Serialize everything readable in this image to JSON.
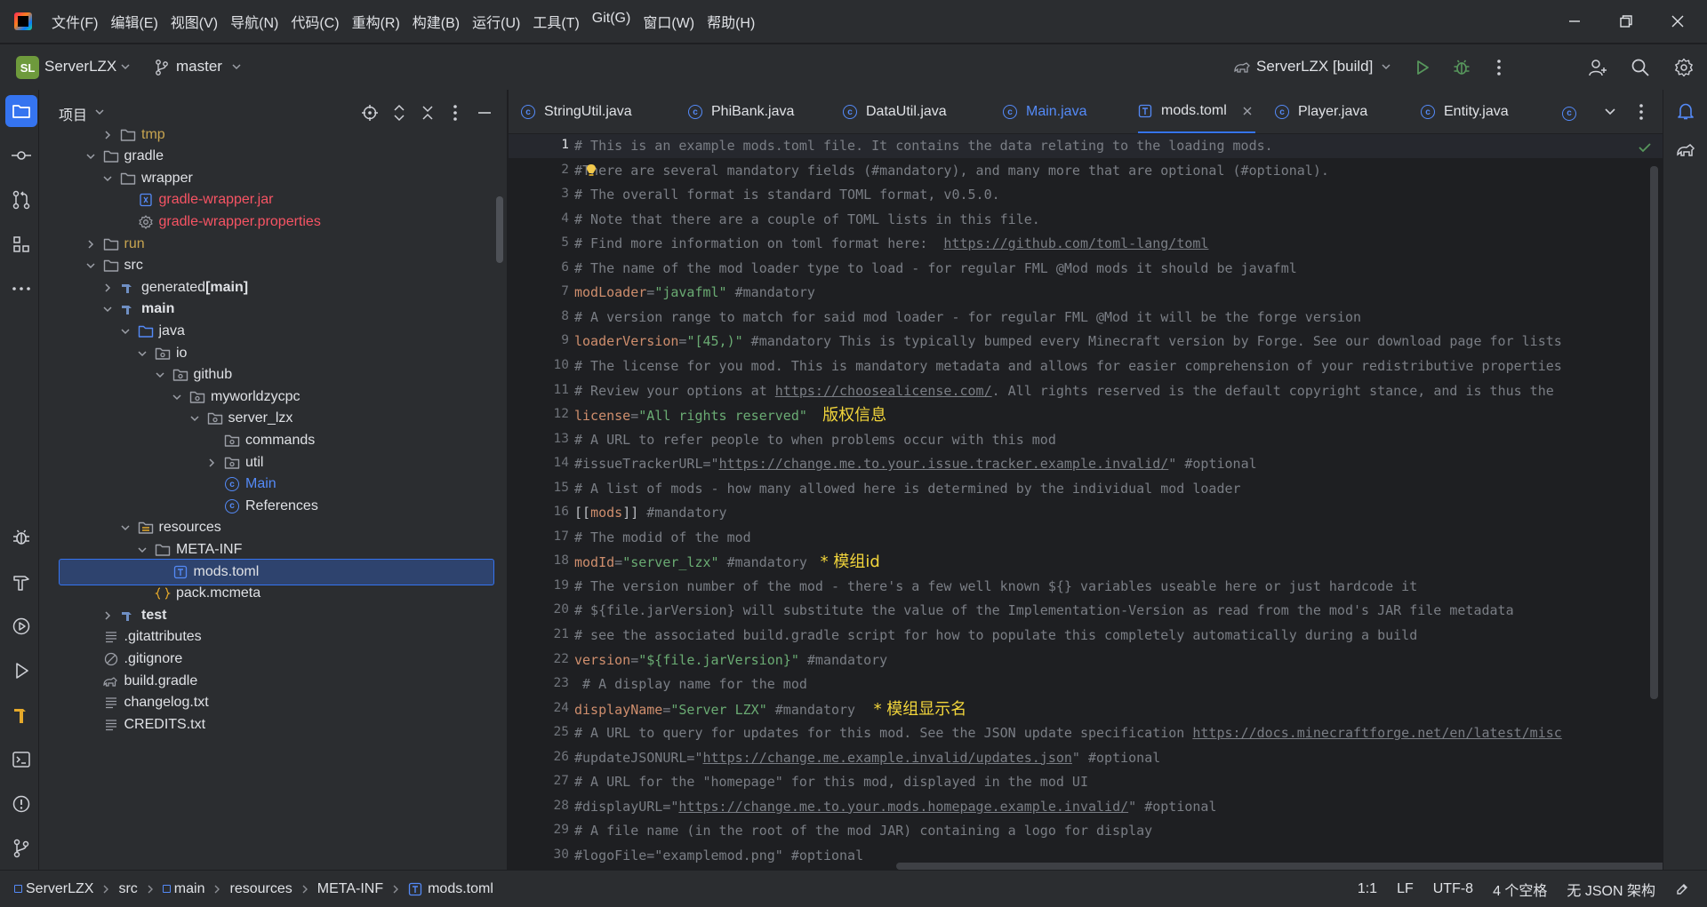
{
  "menubar": {
    "items": [
      "文件(F)",
      "编辑(E)",
      "视图(V)",
      "导航(N)",
      "代码(C)",
      "重构(R)",
      "构建(B)",
      "运行(U)",
      "工具(T)",
      "Git(G)",
      "窗口(W)",
      "帮助(H)"
    ]
  },
  "toolbar": {
    "project_badge": "SL",
    "project_name": "ServerLZX",
    "branch": "master",
    "run_config": "ServerLZX [build]"
  },
  "project_panel": {
    "title": "项目",
    "tree": [
      {
        "label": "tmp",
        "icon": "folder-icon",
        "expanded": false,
        "color": "#c7a450"
      },
      {
        "label": "gradle",
        "icon": "folder-icon",
        "expanded": true,
        "color": "#dfe1e5"
      },
      {
        "label": "wrapper",
        "icon": "folder-icon",
        "expanded": true,
        "color": "#dfe1e5"
      },
      {
        "label": "gradle-wrapper.jar",
        "icon": "jar-icon",
        "color": "#f75464"
      },
      {
        "label": "gradle-wrapper.properties",
        "icon": "gear-icon",
        "color": "#f75464"
      },
      {
        "label": "run",
        "icon": "folder-icon",
        "expanded": false,
        "color": "#c7a450"
      },
      {
        "label": "src",
        "icon": "folder-icon",
        "expanded": true,
        "color": "#dfe1e5"
      },
      {
        "label": "generated",
        "suffix": " [main]",
        "icon": "source-set-icon",
        "expanded": false,
        "color": "#dfe1e5"
      },
      {
        "label": "main",
        "icon": "source-set-icon",
        "expanded": true,
        "color": "#dfe1e5",
        "bold": true
      },
      {
        "label": "java",
        "icon": "source-folder-icon",
        "expanded": true,
        "color": "#dfe1e5"
      },
      {
        "label": "io",
        "icon": "package-icon",
        "expanded": true,
        "color": "#dfe1e5"
      },
      {
        "label": "github",
        "icon": "package-icon",
        "expanded": true,
        "color": "#dfe1e5"
      },
      {
        "label": "myworldzycpc",
        "icon": "package-icon",
        "expanded": true,
        "color": "#dfe1e5"
      },
      {
        "label": "server_lzx",
        "icon": "package-icon",
        "expanded": true,
        "color": "#dfe1e5"
      },
      {
        "label": "commands",
        "icon": "package-icon",
        "color": "#dfe1e5"
      },
      {
        "label": "util",
        "icon": "package-icon",
        "expanded": false,
        "color": "#dfe1e5"
      },
      {
        "label": "Main",
        "icon": "class-icon",
        "color": "#548af7"
      },
      {
        "label": "References",
        "icon": "class-icon",
        "color": "#dfe1e5"
      },
      {
        "label": "resources",
        "icon": "resources-folder-icon",
        "expanded": true,
        "color": "#dfe1e5"
      },
      {
        "label": "META-INF",
        "icon": "folder-icon",
        "expanded": true,
        "color": "#dfe1e5"
      },
      {
        "label": "mods.toml",
        "icon": "toml-icon",
        "color": "#dfe1e5",
        "selected": true
      },
      {
        "label": "pack.mcmeta",
        "icon": "json-icon",
        "color": "#dfe1e5"
      },
      {
        "label": "test",
        "icon": "source-set-icon",
        "expanded": false,
        "color": "#dfe1e5",
        "bold": true
      },
      {
        "label": ".gitattributes",
        "icon": "text-file-icon",
        "color": "#dfe1e5"
      },
      {
        "label": ".gitignore",
        "icon": "ignore-file-icon",
        "color": "#dfe1e5"
      },
      {
        "label": "build.gradle",
        "icon": "gradle-icon",
        "color": "#dfe1e5"
      },
      {
        "label": "changelog.txt",
        "icon": "text-file-icon",
        "color": "#dfe1e5"
      },
      {
        "label": "CREDITS.txt",
        "icon": "text-file-icon",
        "color": "#dfe1e5"
      }
    ]
  },
  "editor": {
    "tabs": [
      {
        "label": "StringUtil.java",
        "icon": "class-icon"
      },
      {
        "label": "PhiBank.java",
        "icon": "class-icon"
      },
      {
        "label": "DataUtil.java",
        "icon": "class-icon"
      },
      {
        "label": "Main.java",
        "icon": "class-icon",
        "color": "#548af7"
      },
      {
        "label": "mods.toml",
        "icon": "toml-icon",
        "active": true
      },
      {
        "label": "Player.java",
        "icon": "class-icon"
      },
      {
        "label": "Entity.java",
        "icon": "class-icon"
      }
    ],
    "lines": [
      [
        [
          "c",
          "# This is an example mods.toml file. It contains the data relating to the loading mods."
        ]
      ],
      [
        [
          "c",
          "#"
        ],
        [
          "bulb",
          ""
        ],
        [
          "c",
          "There are several mandatory fields (#mandatory), and many more that are optional (#optional)."
        ]
      ],
      [
        [
          "c",
          "# The overall format is standard TOML format, v0.5.0."
        ]
      ],
      [
        [
          "c",
          "# Note that there are a couple of TOML lists in this file."
        ]
      ],
      [
        [
          "c",
          "# Find more information on toml format here:  "
        ],
        [
          "l",
          "https://github.com/toml-lang/toml"
        ]
      ],
      [
        [
          "c",
          "# The name of the mod loader type to load - for regular FML @Mod mods it should be javafml"
        ]
      ],
      [
        [
          "k",
          "modLoader"
        ],
        [
          "c",
          "="
        ],
        [
          "s",
          "\"javafml\""
        ],
        [
          "c",
          " #mandatory"
        ]
      ],
      [
        [
          "c",
          "# A version range to match for said mod loader - for regular FML @Mod it will be the forge version"
        ]
      ],
      [
        [
          "k",
          "loaderVersion"
        ],
        [
          "c",
          "="
        ],
        [
          "s",
          "\"[45,)\""
        ],
        [
          "c",
          " #mandatory This is typically bumped every Minecraft version by Forge. See our download page for lists"
        ]
      ],
      [
        [
          "c",
          "# The license for you mod. This is mandatory metadata and allows for easier comprehension of your redistributive properties"
        ]
      ],
      [
        [
          "c",
          "# Review your options at "
        ],
        [
          "l",
          "https://choosealicense.com/"
        ],
        [
          "c",
          ". All rights reserved is the default copyright stance, and is thus the"
        ]
      ],
      [
        [
          "k",
          "license"
        ],
        [
          "c",
          "="
        ],
        [
          "s",
          "\"All rights reserved\""
        ],
        [
          "a",
          "   版权信息"
        ]
      ],
      [
        [
          "c",
          "# A URL to refer people to when problems occur with this mod"
        ]
      ],
      [
        [
          "c",
          "#issueTrackerURL=\""
        ],
        [
          "l",
          "https://change.me.to.your.issue.tracker.example.invalid/"
        ],
        [
          "c",
          "\" #optional"
        ]
      ],
      [
        [
          "c",
          "# A list of mods - how many allowed here is determined by the individual mod loader"
        ]
      ],
      [
        [
          "p",
          "[["
        ],
        [
          "k",
          "mods"
        ],
        [
          "p",
          "]]"
        ],
        [
          "c",
          " #mandatory"
        ]
      ],
      [
        [
          "c",
          "# The modid of the mod"
        ]
      ],
      [
        [
          "k",
          "modId"
        ],
        [
          "c",
          "="
        ],
        [
          "s",
          "\"server_lzx\""
        ],
        [
          "c",
          " #mandatory "
        ],
        [
          "a",
          " * 模组id"
        ]
      ],
      [
        [
          "c",
          "# The version number of the mod - there's a few well known ${} variables useable here or just hardcode it"
        ]
      ],
      [
        [
          "c",
          "# ${file.jarVersion} will substitute the value of the Implementation-Version as read from the mod's JAR file metadata"
        ]
      ],
      [
        [
          "c",
          "# see the associated build.gradle script for how to populate this completely automatically during a build"
        ]
      ],
      [
        [
          "k",
          "version"
        ],
        [
          "c",
          "="
        ],
        [
          "s",
          "\"${file.jarVersion}\""
        ],
        [
          "c",
          " #mandatory"
        ]
      ],
      [
        [
          "c",
          " # A display name for the mod"
        ]
      ],
      [
        [
          "k",
          "displayName"
        ],
        [
          "c",
          "="
        ],
        [
          "s",
          "\"Server LZX\""
        ],
        [
          "c",
          " #mandatory "
        ],
        [
          "a",
          "  * 模组显示名"
        ]
      ],
      [
        [
          "c",
          "# A URL to query for updates for this mod. See the JSON update specification "
        ],
        [
          "l",
          "https://docs.minecraftforge.net/en/latest/misc"
        ]
      ],
      [
        [
          "c",
          "#updateJSONURL=\""
        ],
        [
          "l",
          "https://change.me.example.invalid/updates.json"
        ],
        [
          "c",
          "\" #optional"
        ]
      ],
      [
        [
          "c",
          "# A URL for the \"homepage\" for this mod, displayed in the mod UI"
        ]
      ],
      [
        [
          "c",
          "#displayURL=\""
        ],
        [
          "l",
          "https://change.me.to.your.mods.homepage.example.invalid/"
        ],
        [
          "c",
          "\" #optional"
        ]
      ],
      [
        [
          "c",
          "# A file name (in the root of the mod JAR) containing a logo for display"
        ]
      ],
      [
        [
          "c",
          "#logoFile=\"examplemod.png\" #optional"
        ]
      ]
    ]
  },
  "status_bar": {
    "breadcrumbs": [
      "ServerLZX",
      "src",
      "main",
      "resources",
      "META-INF",
      "mods.toml"
    ],
    "position": "1:1",
    "line_separator": "LF",
    "encoding": "UTF-8",
    "indent": "4 个空格",
    "schema": "无 JSON 架构"
  },
  "colors": {
    "accent": "#3574f0",
    "background": "#1e1f22",
    "panel": "#2b2d30",
    "comment": "#7a7e85",
    "keyword": "#cf8e6d",
    "string": "#6aab73",
    "annotation": "#f2d53b",
    "excluded": "#c7a450",
    "modified": "#f75464"
  }
}
